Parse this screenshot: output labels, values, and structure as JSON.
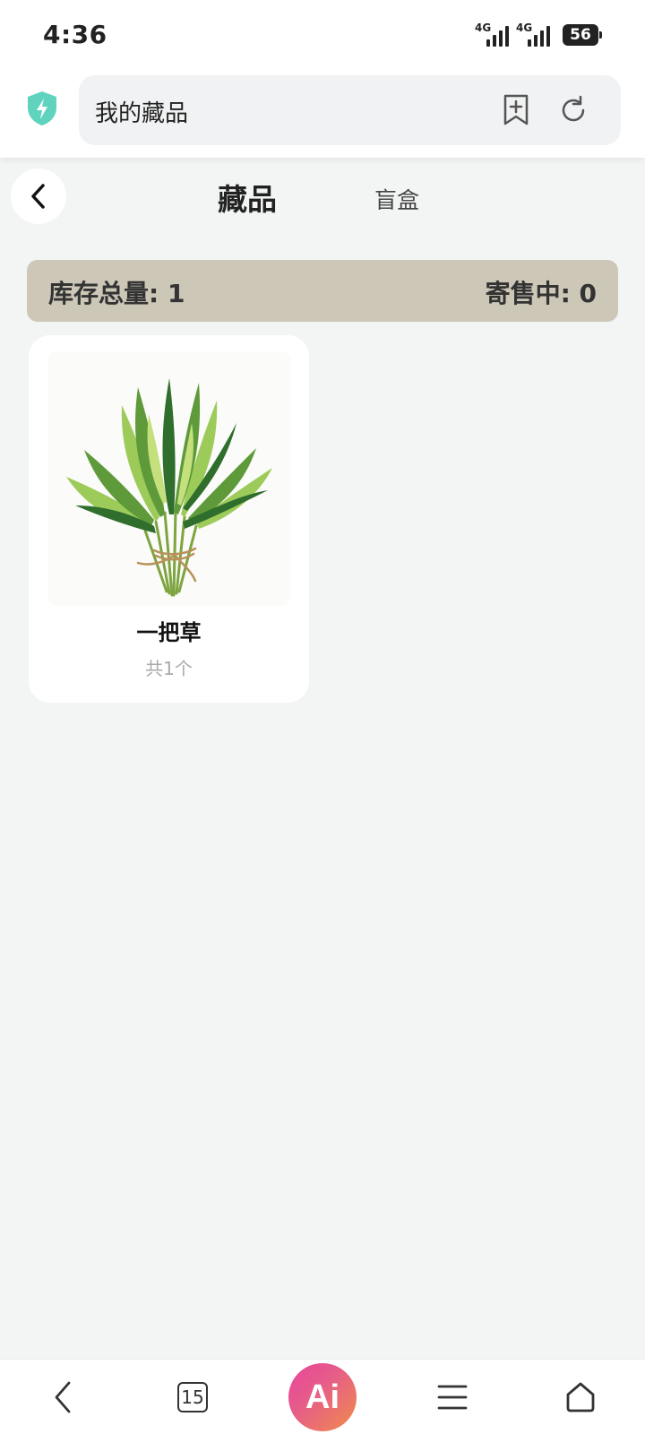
{
  "status_bar": {
    "time": "4:36",
    "network_1": "4G",
    "network_2": "4G",
    "battery": "56"
  },
  "browser": {
    "url_text": "我的藏品",
    "icons": [
      "shield-bolt-icon",
      "add-bookmark-icon",
      "reload-icon"
    ],
    "shield_color": "#5fd3bd"
  },
  "header": {
    "tabs": [
      {
        "label": "藏品",
        "active": true
      },
      {
        "label": "盲盒",
        "active": false
      }
    ]
  },
  "summary": {
    "stock_label": "库存总量: 1",
    "consign_label": "寄售中: 0",
    "background": "#cdc7b8"
  },
  "items": [
    {
      "name": "一把草",
      "count": "共1个",
      "image": "herb-bundle"
    }
  ],
  "bottom_nav": {
    "tab_count": "15",
    "ai_label": "Ai",
    "icons": [
      "back-icon",
      "tabs-icon",
      "ai-icon",
      "menu-icon",
      "home-icon"
    ]
  }
}
